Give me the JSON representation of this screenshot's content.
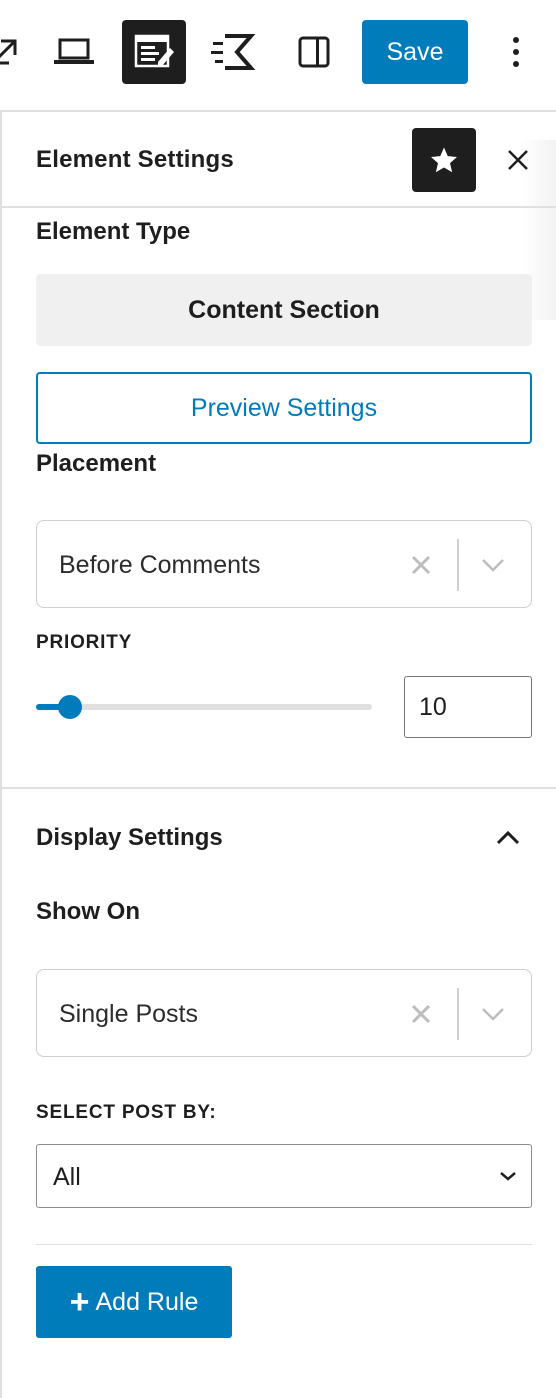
{
  "toolbar": {
    "save_label": "Save",
    "icons": [
      "external-link-icon",
      "desktop-preview-icon",
      "element-editor-icon",
      "speed-icon",
      "sidebar-toggle-icon",
      "more-options-icon"
    ]
  },
  "panel": {
    "title": "Element Settings",
    "element_type_label": "Element Type",
    "element_type_value": "Content Section",
    "preview_settings_label": "Preview Settings",
    "placement_label": "Placement",
    "placement_value": "Before Comments",
    "priority_label": "PRIORITY",
    "priority_value": "10",
    "priority_slider_fraction": 0.1
  },
  "display_settings": {
    "title": "Display Settings",
    "show_on_label": "Show On",
    "show_on_value": "Single Posts",
    "select_post_by_label": "SELECT POST BY:",
    "select_post_by_value": "All",
    "add_rule_label": "Add Rule"
  },
  "colors": {
    "accent": "#007cba",
    "dark": "#1e1e1e",
    "muted_bg": "#f0f0f0",
    "border": "#e0e0e0"
  }
}
